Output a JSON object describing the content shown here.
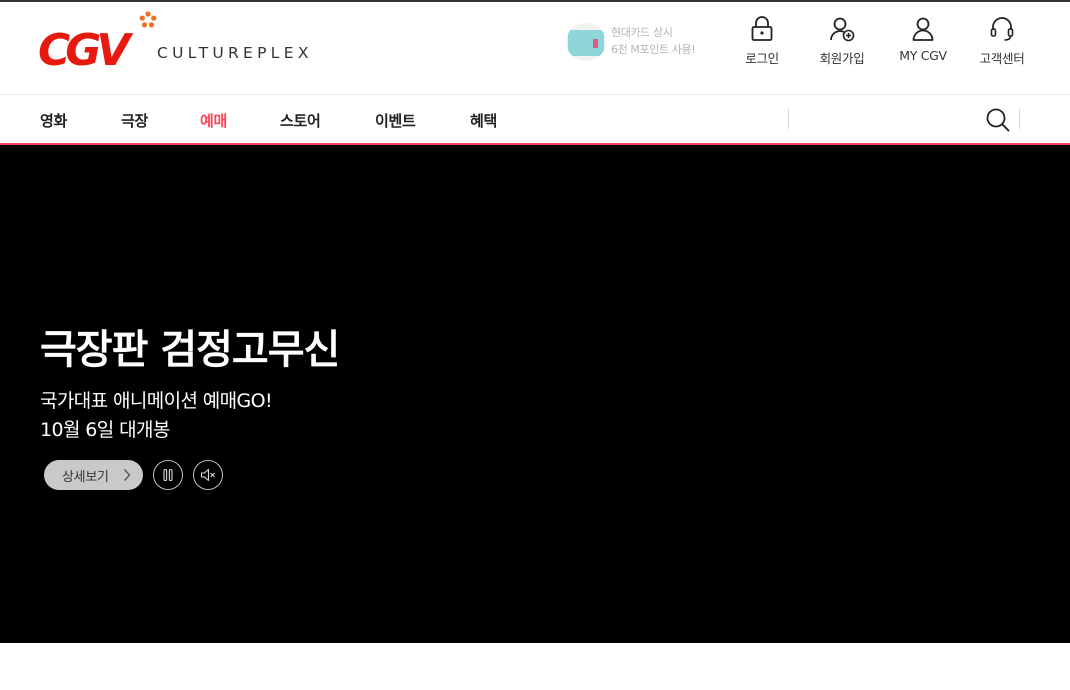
{
  "brand": {
    "logo_text": "CGV",
    "tagline": "CULTUREPLEX",
    "colors": {
      "red": "#e71a0f",
      "accent": "#fb4357"
    }
  },
  "promo": {
    "line1": "현대카드 상시",
    "line2": "6천 M포인트 사용!",
    "icon": "hyundai-card-icon"
  },
  "util_menu": [
    {
      "label": "로그인",
      "icon": "lock-icon"
    },
    {
      "label": "회원가입",
      "icon": "add-user-icon"
    },
    {
      "label": "MY CGV",
      "icon": "user-icon"
    },
    {
      "label": "고객센터",
      "icon": "headset-icon"
    }
  ],
  "nav": {
    "items": [
      {
        "label": "영화"
      },
      {
        "label": "극장"
      },
      {
        "label": "예매",
        "active": true
      },
      {
        "label": "스토어"
      },
      {
        "label": "이벤트"
      },
      {
        "label": "혜택"
      }
    ],
    "search_icon": "search-icon"
  },
  "hero": {
    "title": "극장판 검정고무신",
    "subtitle_line1": "국가대표 애니메이션 예매GO!",
    "subtitle_line2": "10월 6일 대개봉",
    "detail_button": "상세보기",
    "pause_icon": "pause-icon",
    "mute_icon": "mute-icon",
    "background": "#000000"
  }
}
